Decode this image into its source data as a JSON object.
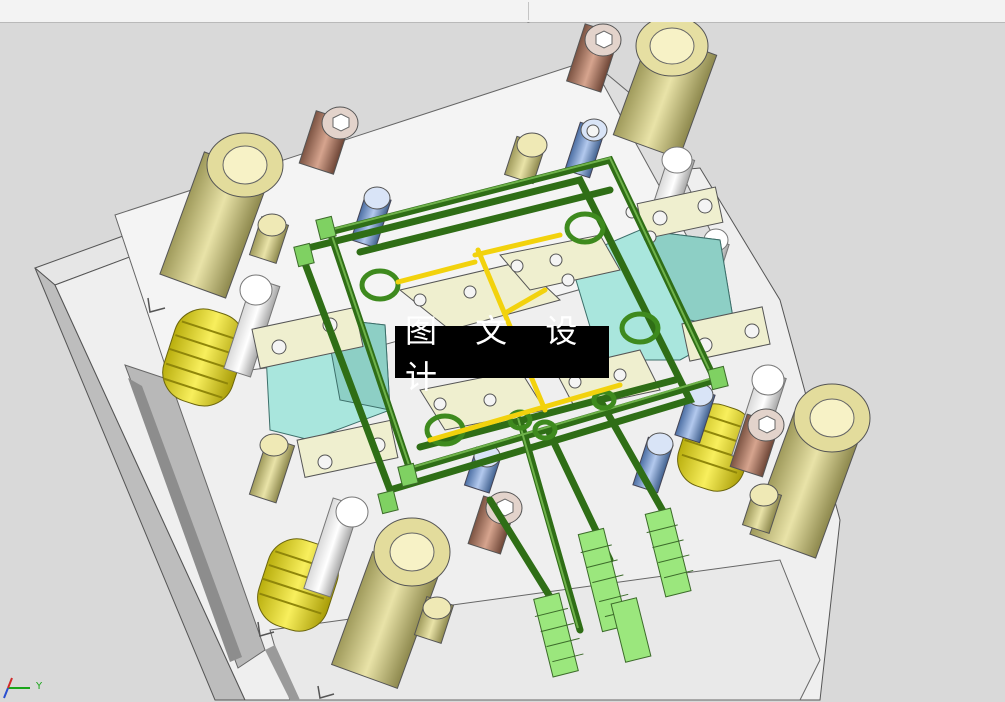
{
  "watermark": {
    "text": "图 文 设 计"
  },
  "triad": {
    "y_label": "Y"
  },
  "colors": {
    "background": "#d9d9d9",
    "plate": "#f1f1f1",
    "plate_shadow": "#a9a9a9",
    "pipe": "#2f6e16",
    "runner": "#f2d20d",
    "slide": "#a9e6dd",
    "spring": "#ede11f",
    "bushing": "#d7cf8a",
    "screw_blue": "#7d9ecf",
    "pin_brown": "#b5826b",
    "fitting": "#9be77d"
  }
}
